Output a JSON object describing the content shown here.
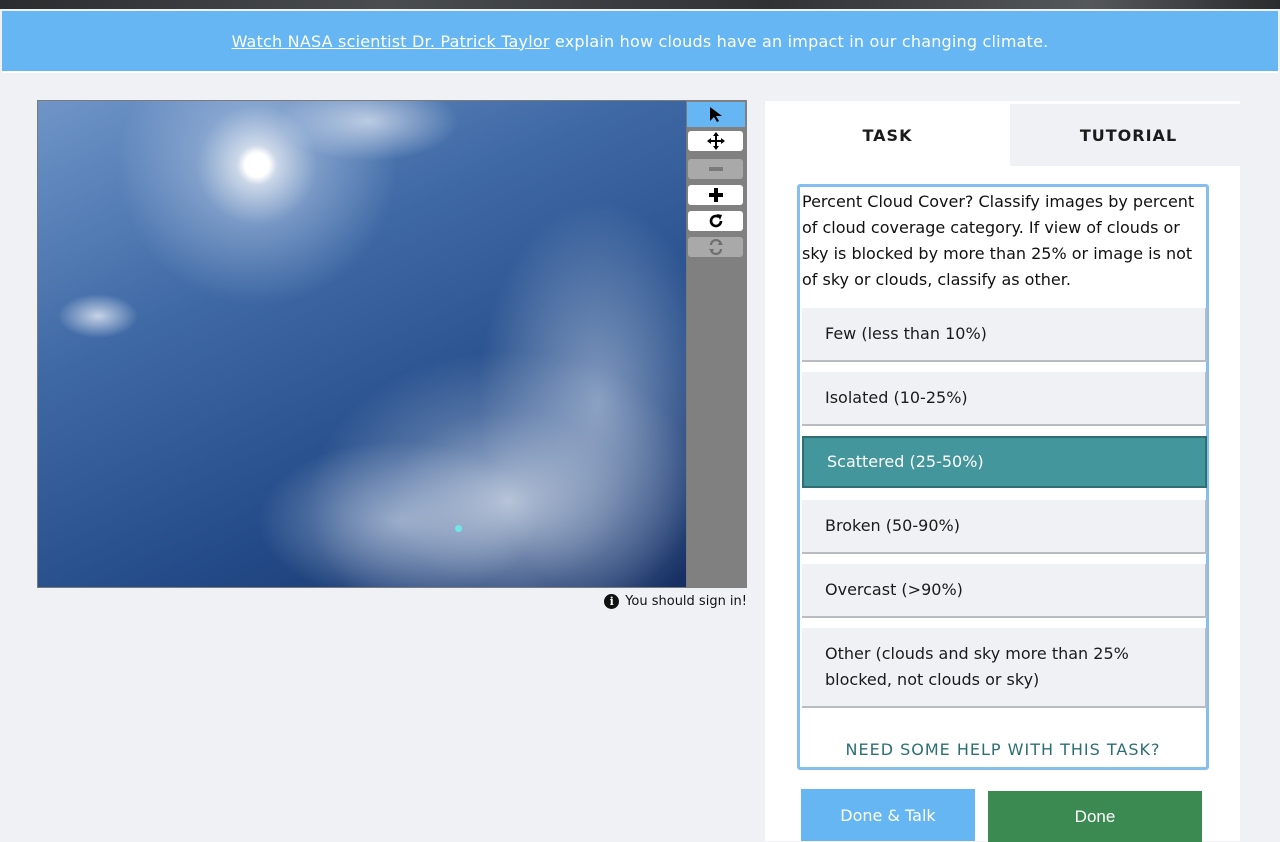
{
  "banner": {
    "link_text": "Watch NASA scientist Dr. Patrick Taylor",
    "rest_text": " explain how clouds have an impact in our changing climate.",
    "color": "#65b6f2"
  },
  "viewer": {
    "tools": [
      {
        "icon": "pointer-icon",
        "glyph": "➤"
      },
      {
        "icon": "move-icon",
        "glyph": "✥"
      },
      {
        "icon": "zoom-out-icon",
        "glyph": "−"
      },
      {
        "icon": "zoom-in-icon",
        "glyph": "+"
      },
      {
        "icon": "rotate-icon",
        "glyph": "↻"
      },
      {
        "icon": "reset-icon",
        "glyph": "⟳"
      }
    ],
    "signin_text": "You should sign in!"
  },
  "tabs": {
    "task": "TASK",
    "tutorial": "TUTORIAL"
  },
  "task": {
    "instruction": "Percent Cloud Cover? Classify images by percent of cloud coverage category. If view of clouds or sky is blocked by more than 25% or image is not of sky or clouds, classify as other.",
    "answers": [
      "Few (less than 10%)",
      "Isolated (10-25%)",
      "Scattered (25-50%)",
      "Broken (50-90%)",
      "Overcast (>90%)",
      "Other (clouds and sky more than 25% blocked, not clouds or sky)"
    ],
    "selected_answer": "Scattered (25-50%)",
    "help_text": "NEED SOME HELP WITH THIS TASK?"
  },
  "buttons": {
    "done_talk": "Done & Talk",
    "done": "Done"
  },
  "colors": {
    "accent_blue": "#65b6f2",
    "selected_teal": "#43969b",
    "done_green": "#3b8a51"
  }
}
